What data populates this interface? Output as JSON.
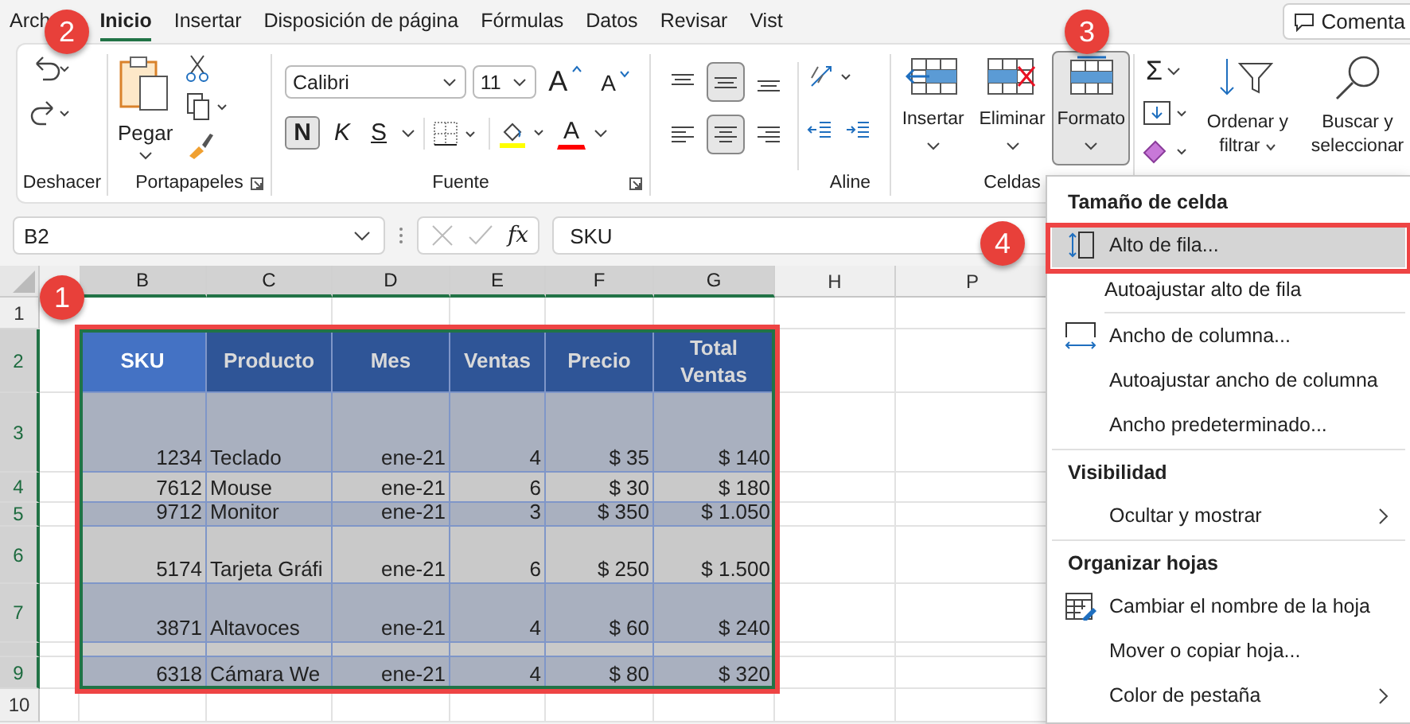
{
  "tabs": [
    {
      "label": "Arch",
      "selected": false
    },
    {
      "label": "Inicio",
      "selected": true
    },
    {
      "label": "Insertar",
      "selected": false
    },
    {
      "label": "Disposición de página",
      "selected": false
    },
    {
      "label": "Fórmulas",
      "selected": false
    },
    {
      "label": "Datos",
      "selected": false
    },
    {
      "label": "Revisar",
      "selected": false
    },
    {
      "label": "Vist",
      "selected": false
    }
  ],
  "comments_button": "Comenta",
  "ribbon": {
    "undo_group": "Deshacer",
    "clipboard": {
      "label": "Portapapeles",
      "paste": "Pegar"
    },
    "font": {
      "label": "Fuente",
      "name": "Calibri",
      "size": "11",
      "grow": "A",
      "shrink": "A",
      "bold": {
        "label": "N",
        "selected": true
      },
      "italic": "K",
      "underline": "S",
      "font_color": "A"
    },
    "alignment": {
      "label": "Aline",
      "buttons": [
        {
          "kind": "top",
          "selected": false
        },
        {
          "kind": "middle",
          "selected": true
        },
        {
          "kind": "bottom",
          "selected": false
        },
        {
          "kind": "left",
          "selected": false
        },
        {
          "kind": "center",
          "selected": true
        },
        {
          "kind": "right",
          "selected": false
        }
      ]
    },
    "cells": {
      "label": "Celdas",
      "buttons": [
        {
          "label": "Insertar",
          "kind": "insert",
          "selected": false
        },
        {
          "label": "Eliminar",
          "kind": "delete",
          "selected": false
        },
        {
          "label": "Formato",
          "kind": "format",
          "selected": true
        }
      ]
    },
    "editing": {
      "sum": "Σ",
      "sort": "Ordenar y filtrar",
      "find": "Buscar y seleccionar"
    }
  },
  "formula_bar": {
    "name_box": "B2",
    "fx": "fx",
    "value": "SKU"
  },
  "sheet": {
    "columns": [
      {
        "label": "B",
        "selected": true
      },
      {
        "label": "C",
        "selected": true
      },
      {
        "label": "D",
        "selected": true
      },
      {
        "label": "E",
        "selected": true
      },
      {
        "label": "F",
        "selected": true
      },
      {
        "label": "G",
        "selected": true
      },
      {
        "label": "H",
        "selected": false
      },
      {
        "label": "P",
        "selected": false
      }
    ],
    "rows": [
      {
        "label": "1",
        "selected": false
      },
      {
        "label": "2",
        "selected": true
      },
      {
        "label": "3",
        "selected": true
      },
      {
        "label": "4",
        "selected": true
      },
      {
        "label": "5",
        "selected": true
      },
      {
        "label": "6",
        "selected": true
      },
      {
        "label": "7",
        "selected": true
      },
      {
        "selected": true
      },
      {
        "label": "9",
        "selected": true
      },
      {
        "label": "10",
        "selected": false
      }
    ]
  },
  "table": {
    "columns": [
      {
        "label": "SKU",
        "active": true
      },
      {
        "label": "Producto",
        "active": false
      },
      {
        "label": "Mes",
        "active": false
      },
      {
        "label": "Ventas",
        "active": false
      },
      {
        "label": "Precio",
        "active": false
      },
      {
        "label": "Total Ventas",
        "active": false
      }
    ],
    "rows": [
      {
        "cells": [
          "1234",
          "Teclado",
          "ene-21",
          "4",
          "$ 35",
          "$ 140"
        ]
      },
      {
        "cells": [
          "7612",
          "Mouse",
          "ene-21",
          "6",
          "$ 30",
          "$ 180"
        ]
      },
      {
        "cells": [
          "9712",
          "Monitor",
          "ene-21",
          "3",
          "$ 350",
          "$ 1.050"
        ]
      },
      {
        "cells": [
          "5174",
          "Tarjeta Gráfi",
          "ene-21",
          "6",
          "$ 250",
          "$ 1.500"
        ]
      },
      {
        "cells": [
          "3871",
          "Altavoces",
          "ene-21",
          "4",
          "$ 60",
          "$ 240"
        ]
      },
      {
        "cells": []
      },
      {
        "cells": [
          "6318",
          "Cámara We",
          "ene-21",
          "4",
          "$ 80",
          "$ 320"
        ]
      }
    ]
  },
  "menu": {
    "sections": [
      {
        "title": "Tamaño de celda",
        "items": [
          {
            "label": "Alto de fila...",
            "kind": "row-height",
            "submenu": false,
            "selected": true
          },
          {
            "label": "Autoajustar alto de fila",
            "submenu": false,
            "selected": false
          },
          {
            "label": "Ancho de columna...",
            "kind": "column-width",
            "submenu": false,
            "selected": false
          },
          {
            "label": "Autoajustar ancho de columna",
            "submenu": false,
            "selected": false
          },
          {
            "label": "Ancho predeterminado...",
            "submenu": false,
            "selected": false
          }
        ]
      },
      {
        "title": "Visibilidad",
        "items": [
          {
            "label": "Ocultar y mostrar",
            "submenu": true,
            "selected": false
          }
        ]
      },
      {
        "title": "Organizar hojas",
        "items": [
          {
            "label": "Cambiar el nombre de la hoja",
            "kind": "rename-sheet",
            "submenu": false,
            "selected": false
          },
          {
            "label": "Mover o copiar hoja...",
            "submenu": false,
            "selected": false
          },
          {
            "label": "Color de pestaña",
            "submenu": true,
            "selected": false
          }
        ]
      }
    ]
  },
  "callouts": [
    "1",
    "2",
    "3",
    "4"
  ]
}
